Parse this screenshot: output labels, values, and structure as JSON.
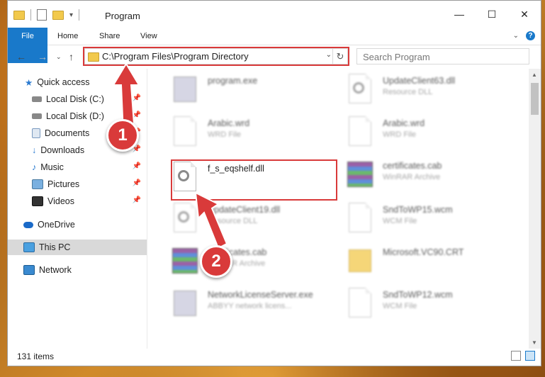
{
  "window": {
    "title": "Program",
    "controls": {
      "minimize": "—",
      "maximize": "☐",
      "close": "✕"
    }
  },
  "ribbon": {
    "tabs": [
      {
        "label": "File"
      },
      {
        "label": "Home"
      },
      {
        "label": "Share"
      },
      {
        "label": "View"
      }
    ]
  },
  "address_bar": {
    "path": "C:\\Program Files\\Program Directory"
  },
  "search": {
    "placeholder": "Search Program"
  },
  "sidebar": {
    "items": [
      {
        "label": "Quick access",
        "icon": "star-icon",
        "pinned": false
      },
      {
        "label": "Local Disk (C:)",
        "icon": "disk-icon",
        "pinned": true
      },
      {
        "label": "Local Disk (D:)",
        "icon": "disk-icon",
        "pinned": true
      },
      {
        "label": "Documents",
        "icon": "documents-icon",
        "pinned": true
      },
      {
        "label": "Downloads",
        "icon": "download-icon",
        "pinned": true
      },
      {
        "label": "Music",
        "icon": "music-icon",
        "pinned": true
      },
      {
        "label": "Pictures",
        "icon": "pictures-icon",
        "pinned": true
      },
      {
        "label": "Videos",
        "icon": "videos-icon",
        "pinned": true
      },
      {
        "label": "OneDrive",
        "icon": "cloud-icon",
        "pinned": false
      },
      {
        "label": "This PC",
        "icon": "computer-icon",
        "pinned": false,
        "selected": true
      },
      {
        "label": "Network",
        "icon": "network-icon",
        "pinned": false
      }
    ]
  },
  "files": [
    {
      "name": "program.exe",
      "desc": "",
      "icon": "exe-icon"
    },
    {
      "name": "UpdateClient63.dll",
      "desc": "Resource DLL",
      "icon": "dll-icon"
    },
    {
      "name": "Arabic.wrd",
      "desc": "WRD File",
      "icon": "file-icon"
    },
    {
      "name": "Arabic.wrd",
      "desc": "WRD File",
      "icon": "file-icon"
    },
    {
      "name": "f_s_eqshelf.dll",
      "desc": "",
      "icon": "dll-icon",
      "highlight": true
    },
    {
      "name": "certificates.cab",
      "desc": "WinRAR Archive",
      "icon": "rar-icon"
    },
    {
      "name": "UpdateClient19.dll",
      "desc": "Resource DLL",
      "icon": "dll-icon"
    },
    {
      "name": "SndToWP15.wcm",
      "desc": "WCM File",
      "icon": "file-icon"
    },
    {
      "name": "certificates.cab",
      "desc": "WinRAR Archive",
      "icon": "rar-icon"
    },
    {
      "name": "Microsoft.VC90.CRT",
      "desc": "",
      "icon": "folder-icon"
    },
    {
      "name": "NetworkLicenseServer.exe",
      "desc": "ABBYY network licens...",
      "icon": "exe-icon"
    },
    {
      "name": "SndToWP12.wcm",
      "desc": "WCM File",
      "icon": "file-icon"
    }
  ],
  "status_bar": {
    "item_count": "131 items"
  },
  "annotations": {
    "step1": "1",
    "step2": "2",
    "highlight_color": "#d93a3a"
  }
}
